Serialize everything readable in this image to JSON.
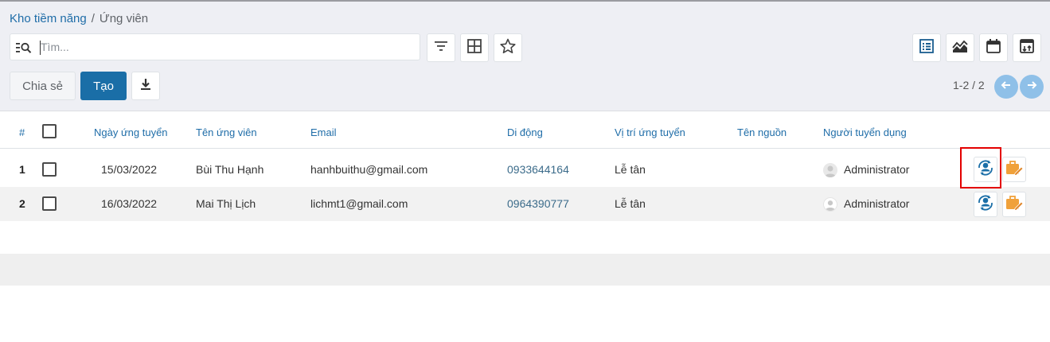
{
  "breadcrumb": {
    "parent": "Kho tiềm năng",
    "separator": "/",
    "current": "Ứng viên"
  },
  "search": {
    "placeholder": "Tìm..."
  },
  "actions": {
    "share_label": "Chia sẻ",
    "create_label": "Tạo"
  },
  "pager": {
    "value": "1-2 / 2"
  },
  "table": {
    "columns": {
      "index": "#",
      "apply_date": "Ngày ứng tuyển",
      "name": "Tên ứng viên",
      "email": "Email",
      "mobile": "Di động",
      "position": "Vị trí ứng tuyển",
      "source": "Tên nguồn",
      "recruiter": "Người tuyển dụng"
    },
    "rows": [
      {
        "index": "1",
        "apply_date": "15/03/2022",
        "name": "Bùi Thu Hạnh",
        "email": "hanhbuithu@gmail.com",
        "mobile": "0933644164",
        "position": "Lễ tân",
        "source": "",
        "recruiter": "Administrator"
      },
      {
        "index": "2",
        "apply_date": "16/03/2022",
        "name": "Mai Thị Lịch",
        "email": "lichmt1@gmail.com",
        "mobile": "0964390777",
        "position": "Lễ tân",
        "source": "",
        "recruiter": "Administrator"
      }
    ]
  },
  "colors": {
    "primary": "#1a6ea7",
    "link": "#1f6da8",
    "highlight": "#e30000",
    "orange_icon": "#f0a13a"
  },
  "icons": {
    "search": "search-icon",
    "filter": "filter-icon",
    "group": "group-by-icon",
    "favorite": "star-icon",
    "list_view": "list-view-icon",
    "pivot_view": "chart-view-icon",
    "calendar_view": "calendar-view-icon",
    "activity_view": "activity-view-icon",
    "download": "download-icon",
    "previous": "arrow-left-icon",
    "next": "arrow-right-icon",
    "convert_employee": "user-sync-icon",
    "job": "briefcase-edit-icon"
  }
}
